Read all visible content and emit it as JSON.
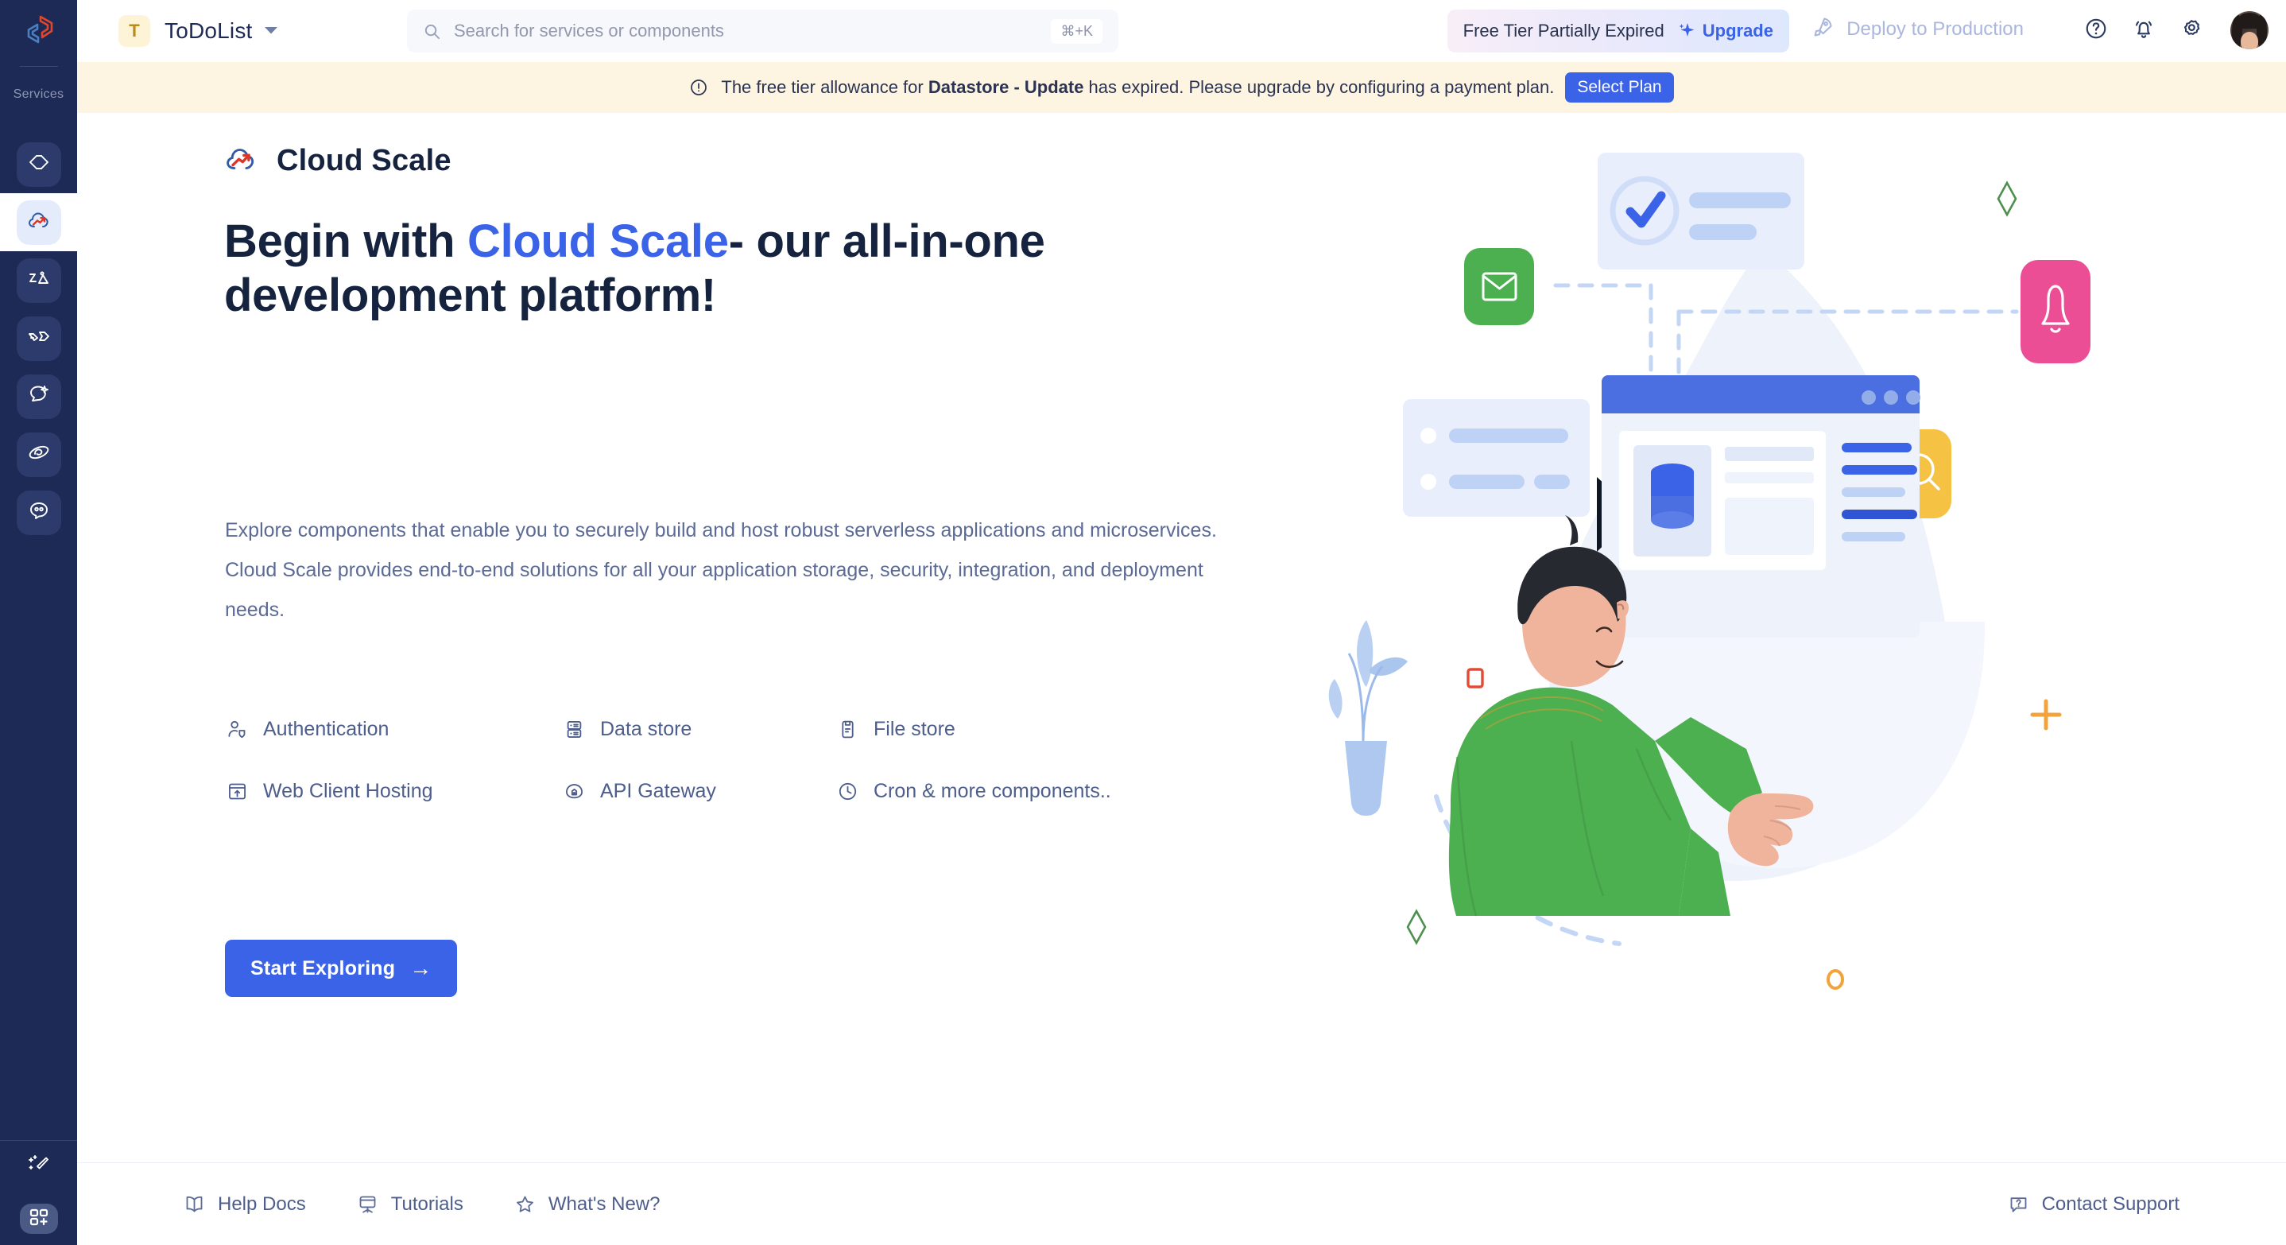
{
  "sidebar": {
    "logo_icon": "app-logo-icon",
    "services_label": "Services",
    "items": [
      {
        "icon": "code-brackets-icon",
        "name": "code-services",
        "active": false
      },
      {
        "icon": "cloud-scale-icon",
        "name": "cloud-scale",
        "active": true
      },
      {
        "icon": "image-media-icon",
        "name": "media-services",
        "active": false
      },
      {
        "icon": "handshake-integration-icon",
        "name": "integrations",
        "active": false
      },
      {
        "icon": "chat-sparkle-icon",
        "name": "ai-assistant",
        "active": false
      },
      {
        "icon": "galaxy-orbit-icon",
        "name": "galaxy-services",
        "active": false
      },
      {
        "icon": "chat-bot-icon",
        "name": "chat-bot",
        "active": false
      }
    ],
    "bottom_items": [
      {
        "icon": "magic-wand-icon",
        "name": "magic-wand",
        "filled": false
      },
      {
        "icon": "add-app-grid-icon",
        "name": "add-app",
        "filled": true
      }
    ]
  },
  "header": {
    "project_initial": "T",
    "project_name": "ToDoList",
    "project_caret_icon": "chevron-down-icon",
    "search": {
      "icon": "search-icon",
      "placeholder": "Search for services or components",
      "shortcut": "⌘+K"
    },
    "upgrade": {
      "status_text": "Free Tier Partially Expired",
      "sparkle_icon": "sparkle-icon",
      "link_label": "Upgrade"
    },
    "deploy": {
      "icon": "rocket-icon",
      "label": "Deploy to Production"
    },
    "icons": [
      {
        "icon": "help-circle-icon",
        "name": "help-button"
      },
      {
        "icon": "bell-icon",
        "name": "notifications-button"
      },
      {
        "icon": "gear-icon",
        "name": "settings-button"
      }
    ],
    "avatar_name": "user-avatar"
  },
  "banner": {
    "icon": "alert-circle-icon",
    "text_before": "The free tier allowance for ",
    "resource": "Datastore - Update",
    "text_after": " has expired. Please upgrade by configuring a payment plan.",
    "button_label": "Select Plan"
  },
  "main": {
    "brand": {
      "logo_icon": "cloud-scale-logo-icon",
      "name": "Cloud Scale"
    },
    "heading": {
      "before": "Begin with ",
      "highlight": "Cloud Scale",
      "after": "- our all-in-one development platform!"
    },
    "paragraph": "Explore components that enable you to securely build and host robust serverless applications and microservices. Cloud Scale provides end-to-end solutions for all your application storage, security, integration, and deployment needs.",
    "features": [
      {
        "icon": "user-shield-icon",
        "label": "Authentication"
      },
      {
        "icon": "database-icon",
        "label": "Data store"
      },
      {
        "icon": "file-store-icon",
        "label": "File store"
      },
      {
        "icon": "web-hosting-icon",
        "label": "Web Client Hosting"
      },
      {
        "icon": "api-gateway-icon",
        "label": "API Gateway"
      },
      {
        "icon": "clock-icon",
        "label": "Cron & more components.."
      }
    ],
    "cta": {
      "label": "Start Exploring",
      "arrow": "→"
    }
  },
  "footer": {
    "left_items": [
      {
        "icon": "book-icon",
        "label": "Help Docs"
      },
      {
        "icon": "presentation-icon",
        "label": "Tutorials"
      },
      {
        "icon": "star-icon",
        "label": "What's New?"
      }
    ],
    "right_item": {
      "icon": "support-chat-icon",
      "label": "Contact Support"
    }
  },
  "colors": {
    "sidebar_bg": "#1d2a55",
    "accent_blue": "#3b63e8",
    "banner_bg": "#fdf4e2",
    "highlight_yellow": "#fbd85d",
    "text_dark": "#16233f",
    "text_muted": "#5c6a96"
  }
}
